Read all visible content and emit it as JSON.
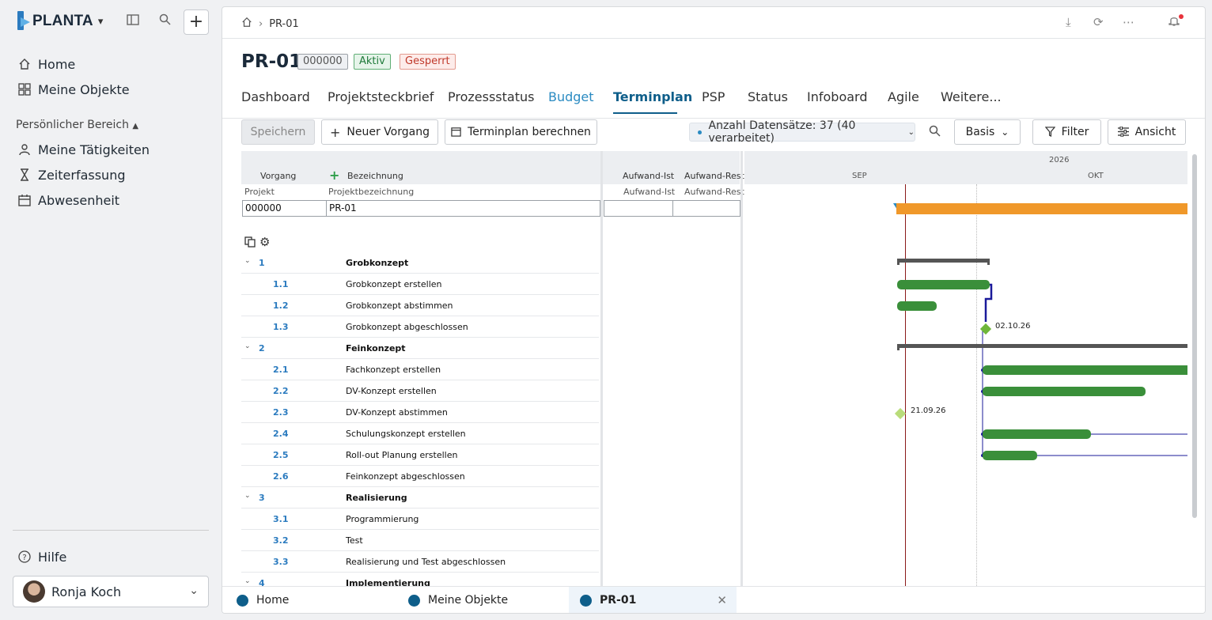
{
  "sidebar": {
    "logo": "PLANTA",
    "nav": [
      {
        "label": "Home",
        "icon": "home-icon"
      },
      {
        "label": "Meine Objekte",
        "icon": "grid-icon"
      }
    ],
    "section_title": "Persönlicher Bereich",
    "personal": [
      {
        "label": "Meine Tätigkeiten",
        "icon": "person-icon"
      },
      {
        "label": "Zeiterfassung",
        "icon": "hourglass-icon"
      },
      {
        "label": "Abwesenheit",
        "icon": "calendar-icon"
      }
    ],
    "help": "Hilfe",
    "user": "Ronja Koch"
  },
  "topbar": {
    "breadcrumb": "PR-01"
  },
  "header": {
    "title": "PR-01",
    "badges": [
      {
        "label": "000000",
        "color": "#555555",
        "bg": "#eef0f3",
        "border": "#9aa0a6"
      },
      {
        "label": "Aktiv",
        "color": "#1f7a3a",
        "bg": "#e6f4ea",
        "border": "#5fae74"
      },
      {
        "label": "Gesperrt",
        "color": "#c0392b",
        "bg": "#fdecea",
        "border": "#e39a8f"
      }
    ]
  },
  "tabs": [
    "Dashboard",
    "Projektsteckbrief",
    "Prozessstatus",
    "Budget",
    "Terminplan",
    "PSP",
    "Status",
    "Infoboard",
    "Agile",
    "Weitere..."
  ],
  "toolbar": {
    "save": "Speichern",
    "new_task": "Neuer Vorgang",
    "calculate": "Terminplan berechnen",
    "records": "Anzahl Datensätze: 37 (40 verarbeitet)",
    "basis": "Basis",
    "filter": "Filter",
    "view": "Ansicht"
  },
  "grid": {
    "headers": {
      "vorgang": "Vorgang",
      "bezeichnung": "Bezeichnung",
      "aufwand_ist": "Aufwand-Ist",
      "aufwand_rest": "Aufwand-Rest"
    },
    "subheaders": {
      "projekt": "Projekt",
      "projektbezeichnung": "Projektbezeichnung",
      "aufwand_ist": "Aufwand-Ist",
      "aufwand_rest": "Aufwand-Rest"
    },
    "project": {
      "id": "000000",
      "name": "PR-01"
    },
    "rows": [
      {
        "num": "1",
        "name": "Grobkonzept",
        "group": true
      },
      {
        "num": "1.1",
        "name": "Grobkonzept erstellen",
        "group": false
      },
      {
        "num": "1.2",
        "name": "Grobkonzept abstimmen",
        "group": false
      },
      {
        "num": "1.3",
        "name": "Grobkonzept abgeschlossen",
        "group": false
      },
      {
        "num": "2",
        "name": "Feinkonzept",
        "group": true
      },
      {
        "num": "2.1",
        "name": "Fachkonzept erstellen",
        "group": false
      },
      {
        "num": "2.2",
        "name": "DV-Konzept erstellen",
        "group": false
      },
      {
        "num": "2.3",
        "name": "DV-Konzept abstimmen",
        "group": false
      },
      {
        "num": "2.4",
        "name": "Schulungskonzept erstellen",
        "group": false
      },
      {
        "num": "2.5",
        "name": "Roll-out Planung erstellen",
        "group": false
      },
      {
        "num": "2.6",
        "name": "Feinkonzept abgeschlossen",
        "group": false
      },
      {
        "num": "3",
        "name": "Realisierung",
        "group": true
      },
      {
        "num": "3.1",
        "name": "Programmierung",
        "group": false
      },
      {
        "num": "3.2",
        "name": "Test",
        "group": false
      },
      {
        "num": "3.3",
        "name": "Realisierung und Test abgeschlossen",
        "group": false
      },
      {
        "num": "4",
        "name": "Implementierung",
        "group": true
      }
    ]
  },
  "gantt": {
    "year": "2026",
    "months": [
      "SEP",
      "OKT"
    ],
    "milestones": [
      "02.10.26",
      "21.09.26"
    ],
    "colors": {
      "project": "#f0982a",
      "task": "#3a8f3a",
      "summary": "#555555",
      "milestone": "#6fb63a",
      "milestone_light": "#b9dc7a",
      "today": "#8b1a1a",
      "link": "#1a1a9a"
    }
  },
  "bottom_tabs": [
    {
      "label": "Home",
      "active": false
    },
    {
      "label": "Meine Objekte",
      "active": false
    },
    {
      "label": "PR-01",
      "active": true
    }
  ]
}
